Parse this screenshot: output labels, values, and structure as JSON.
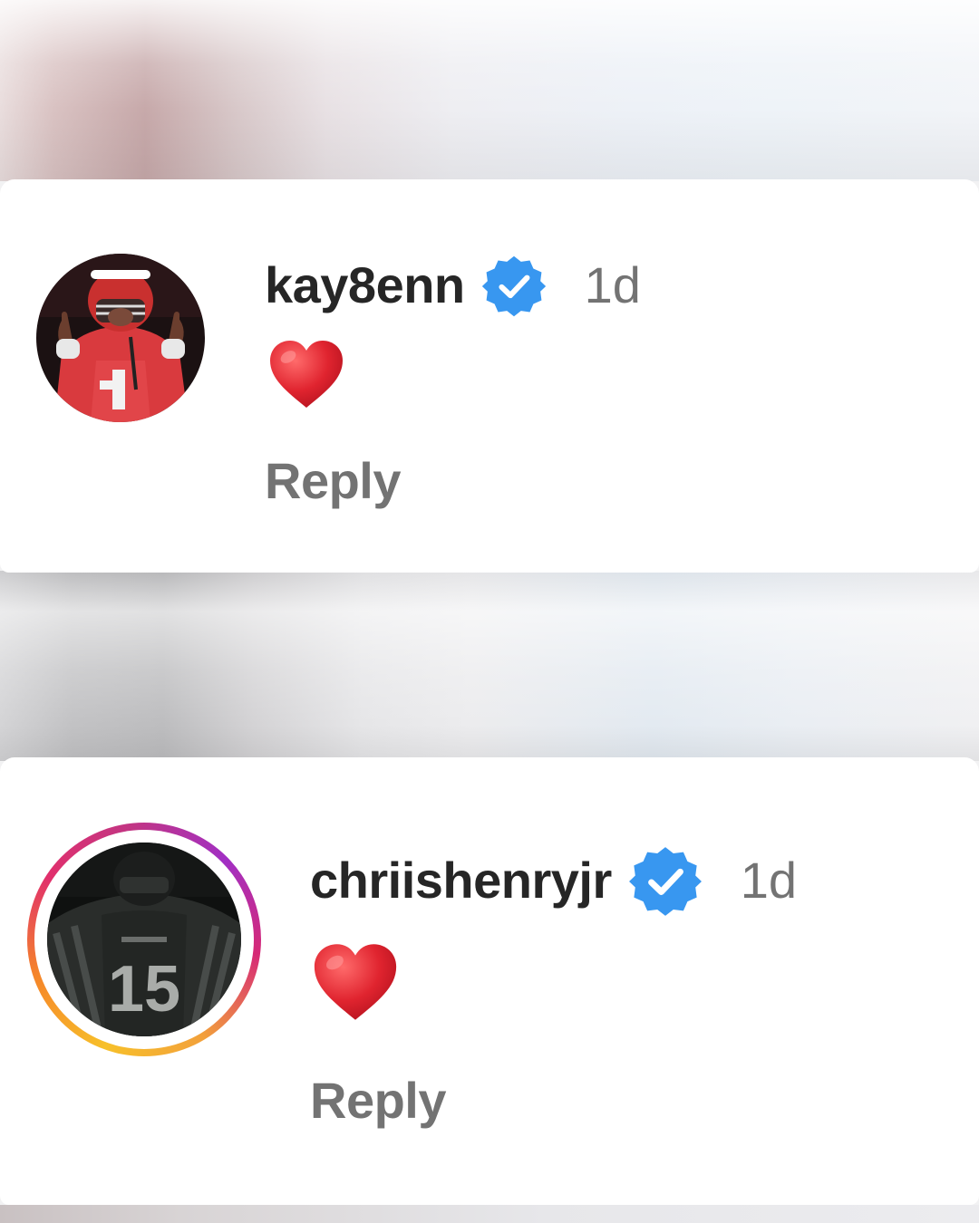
{
  "comments": [
    {
      "username": "kay8enn",
      "verified": true,
      "timestamp": "1d",
      "text_emoji": "red-heart",
      "reply_label": "Reply",
      "avatar_icon": "football-player-red-jersey-avatar",
      "has_story_ring": false
    },
    {
      "username": "chriishenryjr",
      "verified": true,
      "timestamp": "1d",
      "text_emoji": "red-heart",
      "reply_label": "Reply",
      "avatar_icon": "football-player-dark-jersey-avatar",
      "jersey_number": "15",
      "has_story_ring": true
    }
  ],
  "colors": {
    "verified_badge": "#3897f0",
    "username_text": "#262626",
    "secondary_text": "#737373",
    "heart": "#e0242f"
  }
}
